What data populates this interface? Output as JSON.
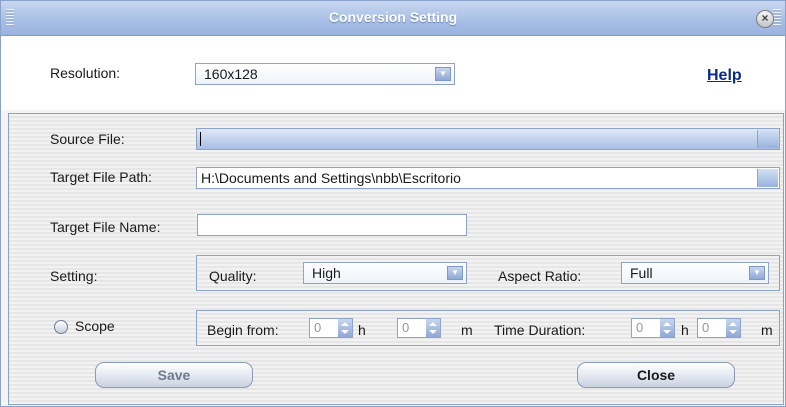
{
  "window": {
    "title": "Conversion Setting"
  },
  "top": {
    "resolution_label": "Resolution:",
    "resolution_value": "160x128",
    "help_link": "Help"
  },
  "form": {
    "source_label": "Source File:",
    "source_value": "",
    "target_path_label": "Target File Path:",
    "target_path_value": "H:\\Documents and Settings\\nbb\\Escritorio",
    "target_name_label": "Target File Name:",
    "target_name_value": "",
    "setting_label": "Setting:",
    "quality_label": "Quality:",
    "quality_value": "High",
    "aspect_label": "Aspect Ratio:",
    "aspect_value": "Full",
    "scope_label": "Scope",
    "begin_label": "Begin from:",
    "begin_h": "0",
    "h_unit": "h",
    "begin_m": "0",
    "m_unit": "m",
    "duration_label": "Time Duration:",
    "duration_h": "0",
    "duration_m": "0"
  },
  "buttons": {
    "save": "Save",
    "close": "Close"
  },
  "colors": {
    "title_bar": "#a8bfe6",
    "help_link": "#0a2a8a",
    "field_border": "#8ea3c7"
  }
}
